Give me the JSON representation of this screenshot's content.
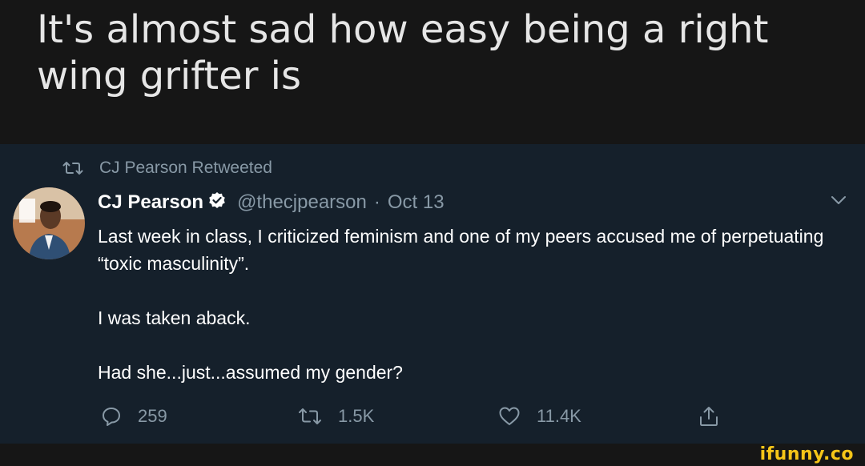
{
  "caption": {
    "text": "It's almost sad how easy being a right wing grifter is"
  },
  "tweet": {
    "retweet_label": "CJ Pearson Retweeted",
    "author": {
      "name": "CJ Pearson",
      "handle": "@thecjpearson",
      "separator": "·",
      "date": "Oct 13"
    },
    "body": {
      "paragraph1": "Last week in class, I criticized feminism and one of my peers accused me of perpetuating “toxic masculinity”.",
      "paragraph2": "I was taken aback.",
      "paragraph3": "Had she...just...assumed my gender?"
    },
    "actions": {
      "replies": "259",
      "retweets": "1.5K",
      "likes": "11.4K"
    }
  },
  "icons": {
    "retweet": "retweet-icon",
    "verified": "verified-badge-icon",
    "more": "chevron-down-icon",
    "reply": "reply-icon",
    "like": "heart-icon",
    "share": "share-icon"
  },
  "colors": {
    "caption_background": "#161616",
    "tweet_background": "#15202b",
    "secondary_text": "#8899a6",
    "watermark": "#f5c518"
  },
  "watermark": {
    "text": "ifunny.co"
  }
}
